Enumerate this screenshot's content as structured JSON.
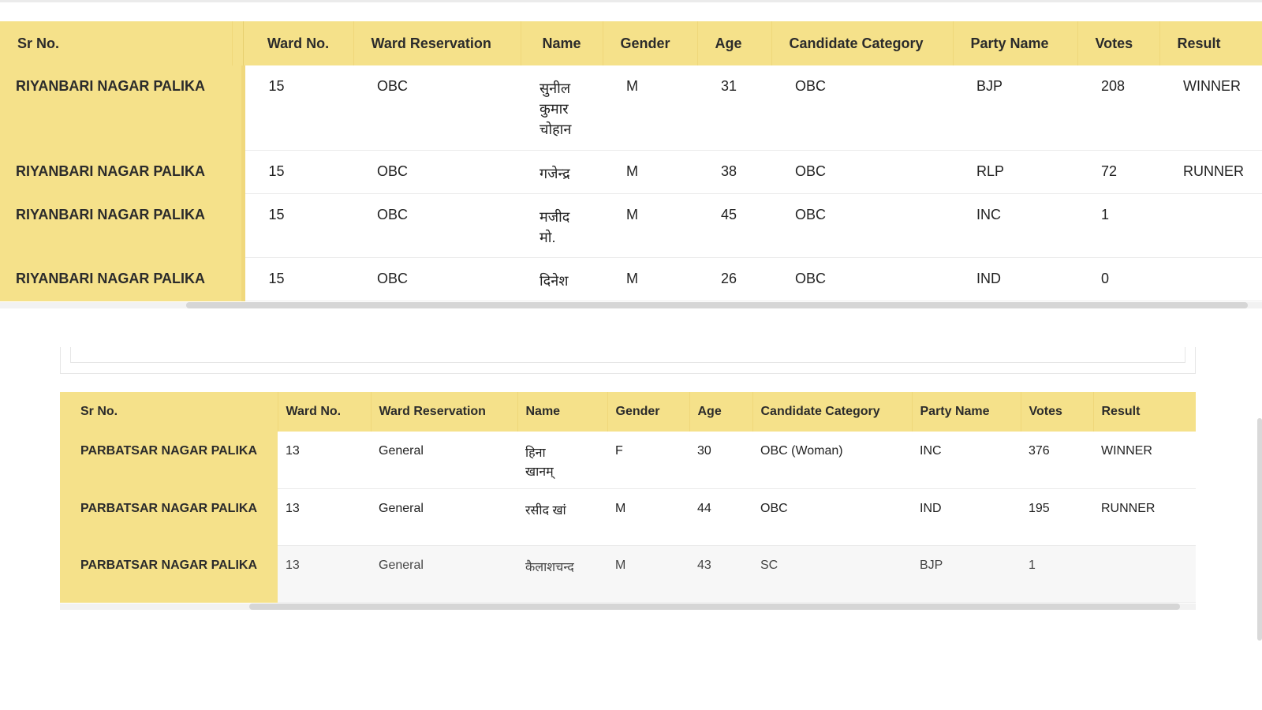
{
  "headers": [
    "Sr No.",
    "Ward No.",
    "Ward Reservation",
    "Name",
    "Gender",
    "Age",
    "Candidate Category",
    "Party Name",
    "Votes",
    "Result"
  ],
  "table1": {
    "rows": [
      {
        "body": "RIYANBARI NAGAR PALIKA",
        "ward": "15",
        "reservation": "OBC",
        "name": "सुनील कुमार चोहान",
        "gender": "M",
        "age": "31",
        "category": "OBC",
        "party": "BJP",
        "votes": "208",
        "result": "WINNER"
      },
      {
        "body": "RIYANBARI NAGAR PALIKA",
        "ward": "15",
        "reservation": "OBC",
        "name": "गजेन्द्र",
        "gender": "M",
        "age": "38",
        "category": "OBC",
        "party": "RLP",
        "votes": "72",
        "result": "RUNNER"
      },
      {
        "body": "RIYANBARI NAGAR PALIKA",
        "ward": "15",
        "reservation": "OBC",
        "name": "मजीद मो.",
        "gender": "M",
        "age": "45",
        "category": "OBC",
        "party": "INC",
        "votes": "1",
        "result": ""
      },
      {
        "body": "RIYANBARI NAGAR PALIKA",
        "ward": "15",
        "reservation": "OBC",
        "name": "दिनेश",
        "gender": "M",
        "age": "26",
        "category": "OBC",
        "party": "IND",
        "votes": "0",
        "result": ""
      }
    ]
  },
  "table2": {
    "rows": [
      {
        "body": "PARBATSAR NAGAR PALIKA",
        "ward": "13",
        "reservation": "General",
        "name": "हिना खानम्",
        "gender": "F",
        "age": "30",
        "category": "OBC (Woman)",
        "party": "INC",
        "votes": "376",
        "result": "WINNER"
      },
      {
        "body": "PARBATSAR NAGAR PALIKA",
        "ward": "13",
        "reservation": "General",
        "name": "रसीद खां",
        "gender": "M",
        "age": "44",
        "category": "OBC",
        "party": "IND",
        "votes": "195",
        "result": "RUNNER"
      },
      {
        "body": "PARBATSAR NAGAR PALIKA",
        "ward": "13",
        "reservation": "General",
        "name": "कैलाशचन्द",
        "gender": "M",
        "age": "43",
        "category": "SC",
        "party": "BJP",
        "votes": "1",
        "result": ""
      }
    ]
  }
}
